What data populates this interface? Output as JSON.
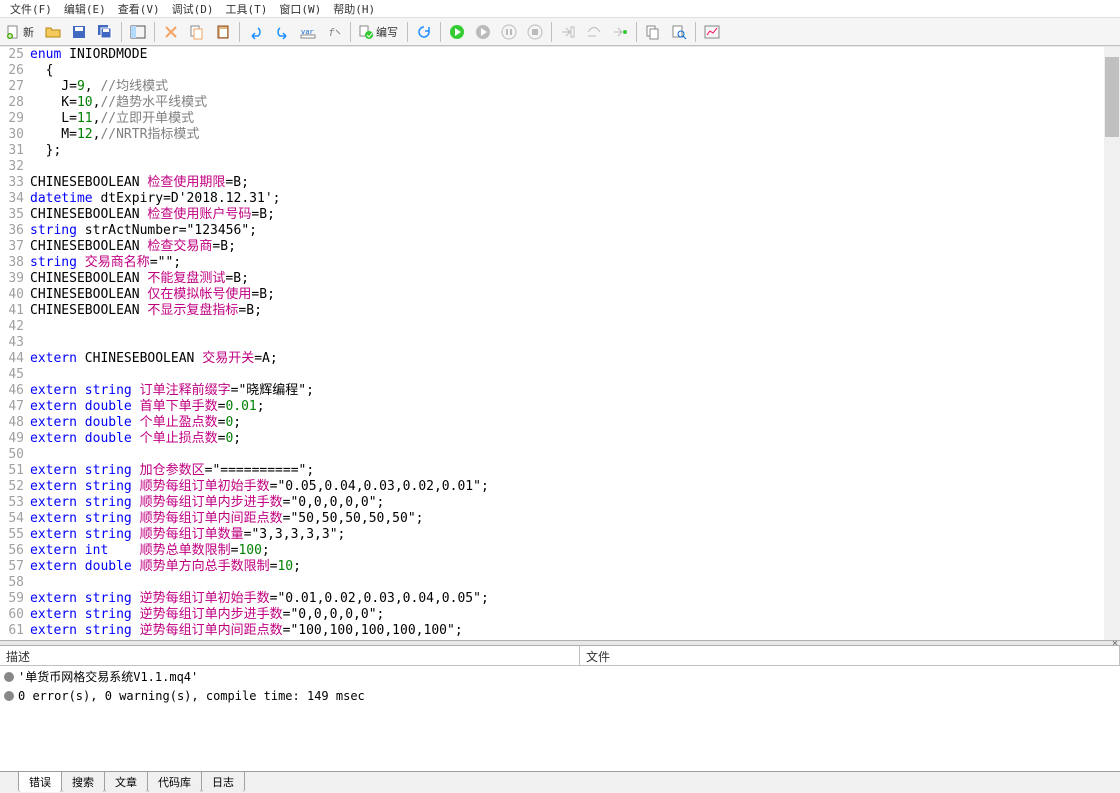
{
  "menu": [
    "文件(F)",
    "编辑(E)",
    "查看(V)",
    "调试(D)",
    "工具(T)",
    "窗口(W)",
    "帮助(H)"
  ],
  "toolbar": {
    "new_label": "新",
    "compile_label": "编写"
  },
  "line_numbers": [
    "25",
    "26",
    "27",
    "28",
    "29",
    "30",
    "31",
    "32",
    "33",
    "34",
    "35",
    "36",
    "37",
    "38",
    "39",
    "40",
    "41",
    "42",
    "43",
    "44",
    "45",
    "46",
    "47",
    "48",
    "49",
    "50",
    "51",
    "52",
    "53",
    "54",
    "55",
    "56",
    "57",
    "58",
    "59",
    "60",
    "61"
  ],
  "code": {
    "l25": {
      "kw": "enum",
      "name": " INIORDMODE"
    },
    "l26": "  {",
    "l27": {
      "pre": "    J=",
      "num": "9",
      "post": ", ",
      "com": "//均线模式"
    },
    "l28": {
      "pre": "    K=",
      "num": "10",
      "post": ",",
      "com": "//趋势水平线模式"
    },
    "l29": {
      "pre": "    L=",
      "num": "11",
      "post": ",",
      "com": "//立即开单模式"
    },
    "l30": {
      "pre": "    M=",
      "num": "12",
      "post": ",",
      "com": "//NRTR指标模式"
    },
    "l31": "  };",
    "l32": "",
    "l33": {
      "p1": "CHINESEBOOLEAN ",
      "cn": "检查使用期限",
      "p2": "=B;"
    },
    "l34": {
      "kw": "datetime",
      "p1": " dtExpiry=",
      "str": "D'2018.12.31'",
      "p2": ";"
    },
    "l35": {
      "p1": "CHINESEBOOLEAN ",
      "cn": "检查使用账户号码",
      "p2": "=B;"
    },
    "l36": {
      "kw": "string",
      "p1": " strActNumber=",
      "str": "\"123456\"",
      "p2": ";"
    },
    "l37": {
      "p1": "CHINESEBOOLEAN ",
      "cn": "检查交易商",
      "p2": "=B;"
    },
    "l38": {
      "kw": "string",
      "p1": " ",
      "cn": "交易商名称",
      "p2": "=",
      "str": "\"\"",
      "p3": ";"
    },
    "l39": {
      "p1": "CHINESEBOOLEAN ",
      "cn": "不能复盘测试",
      "p2": "=B;"
    },
    "l40": {
      "p1": "CHINESEBOOLEAN ",
      "cn": "仅在模拟帐号使用",
      "p2": "=B;"
    },
    "l41": {
      "p1": "CHINESEBOOLEAN ",
      "cn": "不显示复盘指标",
      "p2": "=B;"
    },
    "l42": "",
    "l43": "",
    "l44": {
      "kw": "extern",
      "p1": " CHINESEBOOLEAN ",
      "cn": "交易开关",
      "p2": "=A;"
    },
    "l45": "",
    "l46": {
      "kw1": "extern",
      "kw2": "string",
      "p1": " ",
      "cn": "订单注释前缀字",
      "p2": "=",
      "str": "\"晓辉编程\"",
      "p3": ";"
    },
    "l47": {
      "kw1": "extern",
      "kw2": "double",
      "p1": " ",
      "cn": "首单下单手数",
      "p2": "=",
      "num": "0.01",
      "p3": ";"
    },
    "l48": {
      "kw1": "extern",
      "kw2": "double",
      "p1": " ",
      "cn": "个单止盈点数",
      "p2": "=",
      "num": "0",
      "p3": ";"
    },
    "l49": {
      "kw1": "extern",
      "kw2": "double",
      "p1": " ",
      "cn": "个单止损点数",
      "p2": "=",
      "num": "0",
      "p3": ";"
    },
    "l50": "",
    "l51": {
      "kw1": "extern",
      "kw2": "string",
      "p1": " ",
      "cn": "加仓参数区",
      "p2": "=",
      "str": "\"==========\"",
      "p3": ";"
    },
    "l52": {
      "kw1": "extern",
      "kw2": "string",
      "p1": " ",
      "cn": "顺势每组订单初始手数",
      "p2": "=",
      "str": "\"0.05,0.04,0.03,0.02,0.01\"",
      "p3": ";"
    },
    "l53": {
      "kw1": "extern",
      "kw2": "string",
      "p1": " ",
      "cn": "顺势每组订单内步进手数",
      "p2": "=",
      "str": "\"0,0,0,0,0\"",
      "p3": ";"
    },
    "l54": {
      "kw1": "extern",
      "kw2": "string",
      "p1": " ",
      "cn": "顺势每组订单内间距点数",
      "p2": "=",
      "str": "\"50,50,50,50,50\"",
      "p3": ";"
    },
    "l55": {
      "kw1": "extern",
      "kw2": "string",
      "p1": " ",
      "cn": "顺势每组订单数量",
      "p2": "=",
      "str": "\"3,3,3,3,3\"",
      "p3": ";"
    },
    "l56": {
      "kw1": "extern",
      "kw2": "int   ",
      "p1": " ",
      "cn": "顺势总单数限制",
      "p2": "=",
      "num": "100",
      "p3": ";"
    },
    "l57": {
      "kw1": "extern",
      "kw2": "double",
      "p1": " ",
      "cn": "顺势单方向总手数限制",
      "p2": "=",
      "num": "10",
      "p3": ";"
    },
    "l58": "",
    "l59": {
      "kw1": "extern",
      "kw2": "string",
      "p1": " ",
      "cn": "逆势每组订单初始手数",
      "p2": "=",
      "str": "\"0.01,0.02,0.03,0.04,0.05\"",
      "p3": ";"
    },
    "l60": {
      "kw1": "extern",
      "kw2": "string",
      "p1": " ",
      "cn": "逆势每组订单内步进手数",
      "p2": "=",
      "str": "\"0,0,0,0,0\"",
      "p3": ";"
    },
    "l61": {
      "kw1": "extern",
      "kw2": "string",
      "p1": " ",
      "cn": "逆势每组订单内间距点数",
      "p2": "=",
      "str": "\"100,100,100,100,100\"",
      "p3": ";"
    }
  },
  "output": {
    "col1": "描述",
    "col2": "文件",
    "rows": [
      "'单货币网格交易系统V1.1.mq4'",
      "0 error(s), 0 warning(s), compile time: 149 msec"
    ]
  },
  "bottom_tabs": [
    "错误",
    "搜索",
    "文章",
    "代码库",
    "日志"
  ],
  "colors": {
    "keyword": "#0000ff",
    "number": "#008000",
    "chinese": "#c00080",
    "comment": "#808080"
  }
}
